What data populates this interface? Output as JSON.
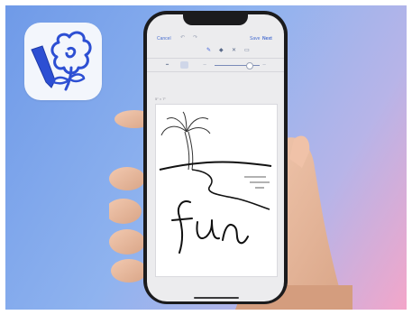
{
  "toolbar": {
    "cancel_label": "Cancel",
    "save_label": "Save",
    "next_label": "Next"
  },
  "canvas": {
    "size_label": "5″ × 7″",
    "handwriting_text": "fun"
  },
  "icons": {
    "app_icon": "flower-pen-icon",
    "undo": "undo-icon",
    "redo": "redo-icon",
    "pen": "pen-icon",
    "eraser": "eraser-icon",
    "lasso": "lasso-icon",
    "layers": "layers-icon"
  },
  "colors": {
    "accent": "#4a6fd0",
    "icon_blue": "#3a5bd9"
  }
}
